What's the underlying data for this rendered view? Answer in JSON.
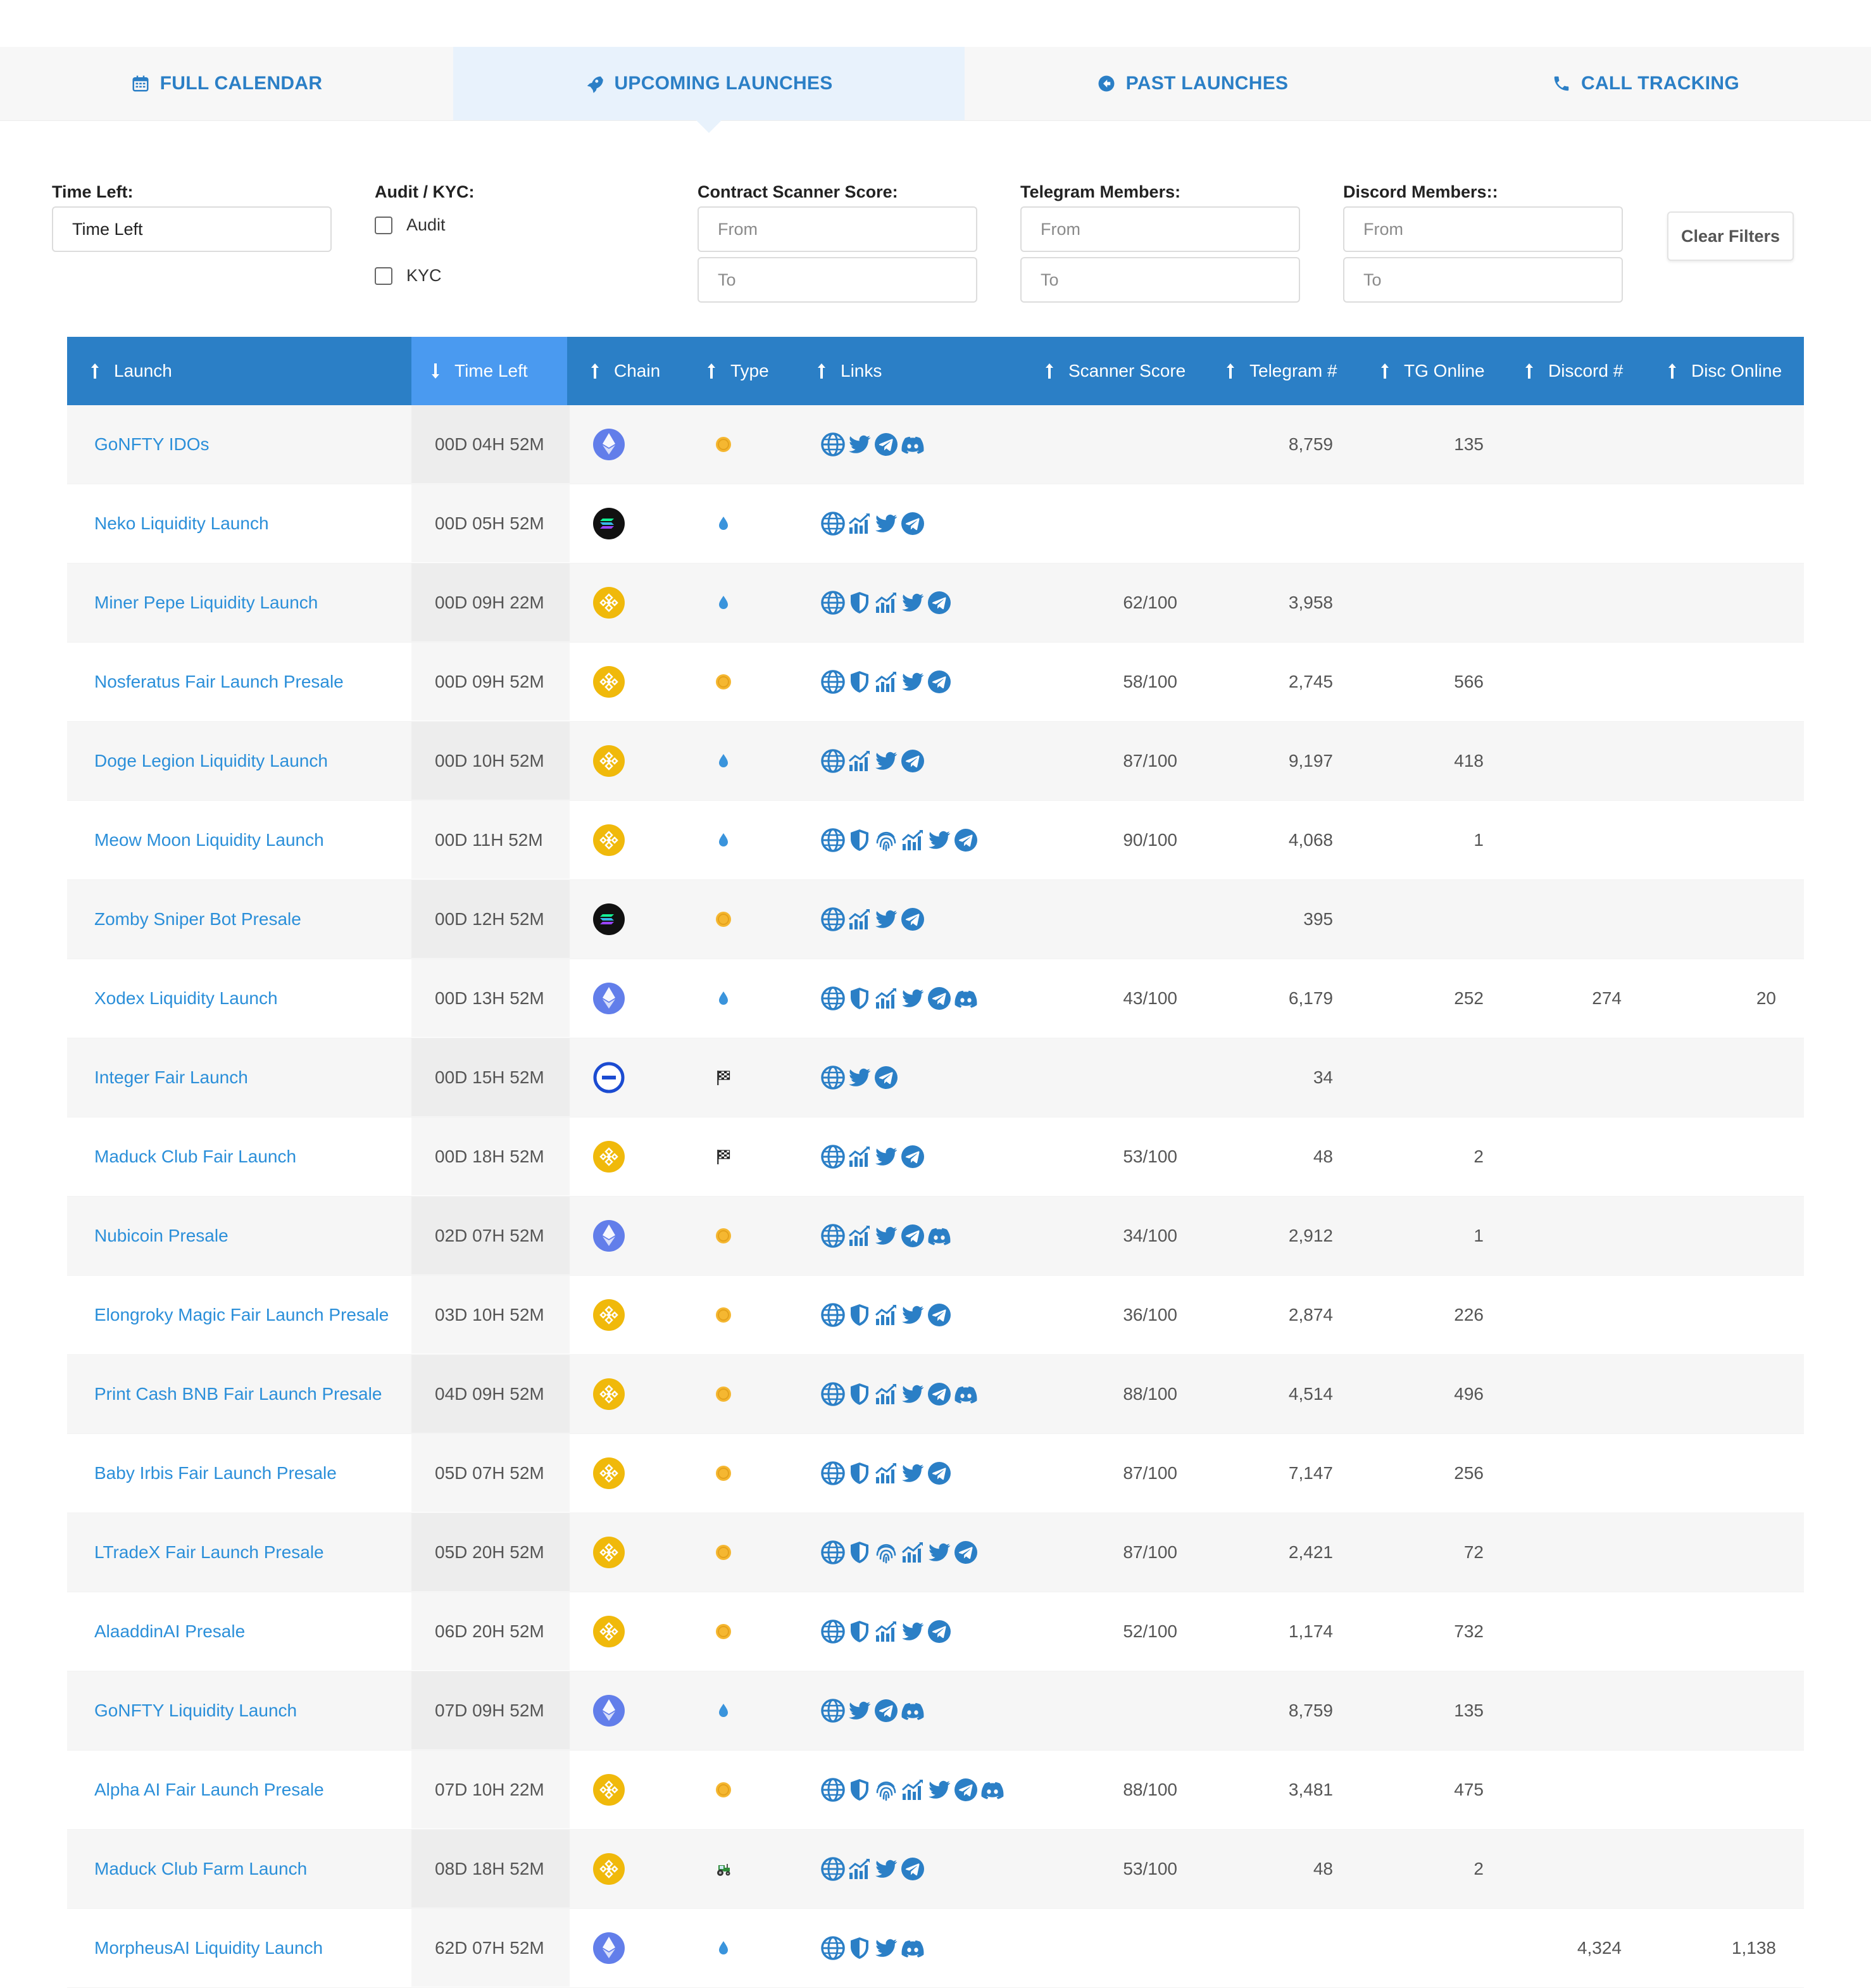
{
  "tabs": [
    {
      "label": "FULL CALENDAR",
      "icon": "calendar-icon",
      "active": false
    },
    {
      "label": "UPCOMING LAUNCHES",
      "icon": "rocket-icon",
      "active": true
    },
    {
      "label": "PAST LAUNCHES",
      "icon": "circle-arrow-left-icon",
      "active": false
    },
    {
      "label": "CALL TRACKING",
      "icon": "phone-icon",
      "active": false
    }
  ],
  "filters": {
    "time_left": {
      "label": "Time Left:",
      "value": "Time Left"
    },
    "audit_kyc": {
      "label": "Audit / KYC:",
      "audit_label": "Audit",
      "kyc_label": "KYC"
    },
    "scanner": {
      "label": "Contract Scanner Score:",
      "from_placeholder": "From",
      "to_placeholder": "To"
    },
    "telegram": {
      "label": "Telegram Members:",
      "from_placeholder": "From",
      "to_placeholder": "To"
    },
    "discord": {
      "label": "Discord Members::",
      "from_placeholder": "From",
      "to_placeholder": "To"
    },
    "clear_label": "Clear Filters"
  },
  "table": {
    "columns": [
      "Launch",
      "Time Left",
      "Chain",
      "Type",
      "Links",
      "Scanner Score",
      "Telegram #",
      "TG Online",
      "Discord #",
      "Disc Online"
    ],
    "rows": [
      {
        "launch": "GoNFTY IDOs",
        "time": "00D 04H 52M",
        "chain": "eth",
        "type": "coin",
        "links": [
          "web",
          "twitter",
          "telegram",
          "discord"
        ],
        "score": "",
        "tg": "8,759",
        "tgon": "135",
        "disc": "",
        "discon": ""
      },
      {
        "launch": "Neko Liquidity Launch",
        "time": "00D 05H 52M",
        "chain": "sol",
        "type": "drop",
        "links": [
          "web",
          "chart",
          "twitter",
          "telegram"
        ],
        "score": "",
        "tg": "",
        "tgon": "",
        "disc": "",
        "discon": ""
      },
      {
        "launch": "Miner Pepe Liquidity Launch",
        "time": "00D 09H 22M",
        "chain": "bnb",
        "type": "drop",
        "links": [
          "web",
          "shield",
          "chart",
          "twitter",
          "telegram"
        ],
        "score": "62/100",
        "tg": "3,958",
        "tgon": "",
        "disc": "",
        "discon": ""
      },
      {
        "launch": "Nosferatus Fair Launch Presale",
        "time": "00D 09H 52M",
        "chain": "bnb",
        "type": "coin",
        "links": [
          "web",
          "shield",
          "chart",
          "twitter",
          "telegram"
        ],
        "score": "58/100",
        "tg": "2,745",
        "tgon": "566",
        "disc": "",
        "discon": ""
      },
      {
        "launch": "Doge Legion Liquidity Launch",
        "time": "00D 10H 52M",
        "chain": "bnb",
        "type": "drop",
        "links": [
          "web",
          "chart",
          "twitter",
          "telegram"
        ],
        "score": "87/100",
        "tg": "9,197",
        "tgon": "418",
        "disc": "",
        "discon": ""
      },
      {
        "launch": "Meow Moon Liquidity Launch",
        "time": "00D 11H 52M",
        "chain": "bnb",
        "type": "drop",
        "links": [
          "web",
          "shield",
          "fingerprint",
          "chart",
          "twitter",
          "telegram"
        ],
        "score": "90/100",
        "tg": "4,068",
        "tgon": "1",
        "disc": "",
        "discon": ""
      },
      {
        "launch": "Zomby Sniper Bot Presale",
        "time": "00D 12H 52M",
        "chain": "sol",
        "type": "coin",
        "links": [
          "web",
          "chart",
          "twitter",
          "telegram"
        ],
        "score": "",
        "tg": "395",
        "tgon": "",
        "disc": "",
        "discon": ""
      },
      {
        "launch": "Xodex Liquidity Launch",
        "time": "00D 13H 52M",
        "chain": "eth",
        "type": "drop",
        "links": [
          "web",
          "shield",
          "chart",
          "twitter",
          "telegram",
          "discord"
        ],
        "score": "43/100",
        "tg": "6,179",
        "tgon": "252",
        "disc": "274",
        "discon": "20"
      },
      {
        "launch": "Integer Fair Launch",
        "time": "00D 15H 52M",
        "chain": "ring",
        "type": "flag",
        "links": [
          "web",
          "twitter",
          "telegram"
        ],
        "score": "",
        "tg": "34",
        "tgon": "",
        "disc": "",
        "discon": ""
      },
      {
        "launch": "Maduck Club Fair Launch",
        "time": "00D 18H 52M",
        "chain": "bnb",
        "type": "flag",
        "links": [
          "web",
          "chart",
          "twitter",
          "telegram"
        ],
        "score": "53/100",
        "tg": "48",
        "tgon": "2",
        "disc": "",
        "discon": ""
      },
      {
        "launch": "Nubicoin Presale",
        "time": "02D 07H 52M",
        "chain": "eth",
        "type": "coin",
        "links": [
          "web",
          "chart",
          "twitter",
          "telegram",
          "discord"
        ],
        "score": "34/100",
        "tg": "2,912",
        "tgon": "1",
        "disc": "",
        "discon": ""
      },
      {
        "launch": "Elongroky Magic Fair Launch Presale",
        "time": "03D 10H 52M",
        "chain": "bnb",
        "type": "coin",
        "links": [
          "web",
          "shield",
          "chart",
          "twitter",
          "telegram"
        ],
        "score": "36/100",
        "tg": "2,874",
        "tgon": "226",
        "disc": "",
        "discon": ""
      },
      {
        "launch": "Print Cash BNB Fair Launch Presale",
        "time": "04D 09H 52M",
        "chain": "bnb",
        "type": "coin",
        "links": [
          "web",
          "shield",
          "chart",
          "twitter",
          "telegram",
          "discord"
        ],
        "score": "88/100",
        "tg": "4,514",
        "tgon": "496",
        "disc": "",
        "discon": ""
      },
      {
        "launch": "Baby Irbis Fair Launch Presale",
        "time": "05D 07H 52M",
        "chain": "bnb",
        "type": "coin",
        "links": [
          "web",
          "shield",
          "chart",
          "twitter",
          "telegram"
        ],
        "score": "87/100",
        "tg": "7,147",
        "tgon": "256",
        "disc": "",
        "discon": ""
      },
      {
        "launch": "LTradeX Fair Launch Presale",
        "time": "05D 20H 52M",
        "chain": "bnb",
        "type": "coin",
        "links": [
          "web",
          "shield",
          "fingerprint",
          "chart",
          "twitter",
          "telegram"
        ],
        "score": "87/100",
        "tg": "2,421",
        "tgon": "72",
        "disc": "",
        "discon": ""
      },
      {
        "launch": "AlaaddinAI Presale",
        "time": "06D 20H 52M",
        "chain": "bnb",
        "type": "coin",
        "links": [
          "web",
          "shield",
          "chart",
          "twitter",
          "telegram"
        ],
        "score": "52/100",
        "tg": "1,174",
        "tgon": "732",
        "disc": "",
        "discon": ""
      },
      {
        "launch": "GoNFTY Liquidity Launch",
        "time": "07D 09H 52M",
        "chain": "eth",
        "type": "drop",
        "links": [
          "web",
          "twitter",
          "telegram",
          "discord"
        ],
        "score": "",
        "tg": "8,759",
        "tgon": "135",
        "disc": "",
        "discon": ""
      },
      {
        "launch": "Alpha AI Fair Launch Presale",
        "time": "07D 10H 22M",
        "chain": "bnb",
        "type": "coin",
        "links": [
          "web",
          "shield",
          "fingerprint",
          "chart",
          "twitter",
          "telegram",
          "discord"
        ],
        "score": "88/100",
        "tg": "3,481",
        "tgon": "475",
        "disc": "",
        "discon": ""
      },
      {
        "launch": "Maduck Club Farm Launch",
        "time": "08D 18H 52M",
        "chain": "bnb",
        "type": "tractor",
        "links": [
          "web",
          "chart",
          "twitter",
          "telegram"
        ],
        "score": "53/100",
        "tg": "48",
        "tgon": "2",
        "disc": "",
        "discon": ""
      },
      {
        "launch": "MorpheusAI Liquidity Launch",
        "time": "62D 07H 52M",
        "chain": "eth",
        "type": "drop",
        "links": [
          "web",
          "shield",
          "twitter",
          "discord"
        ],
        "score": "",
        "tg": "",
        "tgon": "",
        "disc": "4,324",
        "discon": "1,138"
      }
    ]
  },
  "colors": {
    "accent": "#2b7fc6",
    "header_sorted": "#4a9af0",
    "link_text": "#2b8fd9",
    "bnb": "#f0b90b",
    "eth": "#627eea",
    "coin": "#f5b731"
  }
}
